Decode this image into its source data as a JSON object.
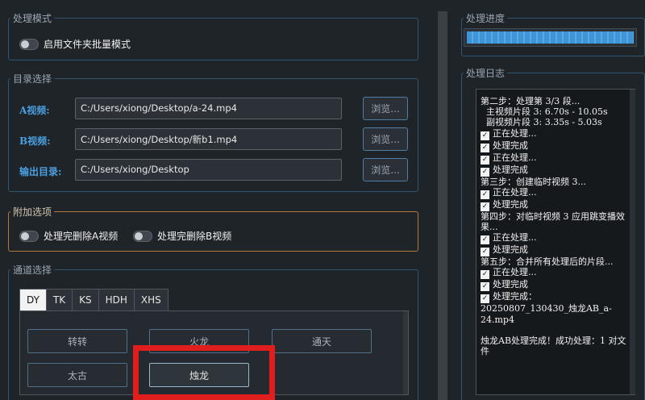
{
  "processing_mode": {
    "legend": "处理模式",
    "batch_toggle_label": "启用文件夹批量模式"
  },
  "directory": {
    "legend": "目录选择",
    "rows": [
      {
        "label": "A视频:",
        "value": "C:/Users/xiong/Desktop/a-24.mp4",
        "button": "浏览..."
      },
      {
        "label": "B视频:",
        "value": "C:/Users/xiong/Desktop/新b1.mp4",
        "button": "浏览..."
      },
      {
        "label": "输出目录:",
        "value": "C:/Users/xiong/Desktop",
        "button": "浏览..."
      }
    ]
  },
  "extra_options": {
    "legend": "附加选项",
    "delete_a_label": "处理完删除A视频",
    "delete_b_label": "处理完删除B视频"
  },
  "channel": {
    "legend": "通道选择",
    "tabs": [
      "DY",
      "TK",
      "KS",
      "HDH",
      "XHS"
    ],
    "active_tab": "DY",
    "buttons": [
      "转转",
      "火龙",
      "通天",
      "太古",
      "烛龙"
    ],
    "selected_button": "烛龙"
  },
  "progress": {
    "legend": "处理进度",
    "fraction": 1.0
  },
  "log": {
    "legend": "处理日志",
    "lines": [
      {
        "check": false,
        "text": "第二步：处理第 3/3 段..."
      },
      {
        "check": false,
        "text": "  主视频片段 3: 6.70s - 10.05s"
      },
      {
        "check": false,
        "text": "  副视频片段 3: 3.35s - 5.03s"
      },
      {
        "check": true,
        "text": "正在处理..."
      },
      {
        "check": true,
        "text": "处理完成"
      },
      {
        "check": true,
        "text": "正在处理..."
      },
      {
        "check": true,
        "text": "处理完成"
      },
      {
        "check": false,
        "text": "第三步：创建临时视频 3..."
      },
      {
        "check": true,
        "text": "正在处理..."
      },
      {
        "check": true,
        "text": "处理完成"
      },
      {
        "check": false,
        "text": "第四步：对临时视频 3 应用跳变播效果..."
      },
      {
        "check": true,
        "text": "正在处理..."
      },
      {
        "check": true,
        "text": "处理完成"
      },
      {
        "check": false,
        "text": "第五步：合并所有处理后的片段..."
      },
      {
        "check": true,
        "text": "正在处理..."
      },
      {
        "check": true,
        "text": "处理完成"
      },
      {
        "check": true,
        "text": "处理完成："
      },
      {
        "check": false,
        "text": "20250807_130430_烛龙AB_a-24.mp4"
      },
      {
        "check": false,
        "text": ""
      },
      {
        "check": false,
        "text": "烛龙AB处理完成！成功处理：1 对文件"
      }
    ]
  }
}
